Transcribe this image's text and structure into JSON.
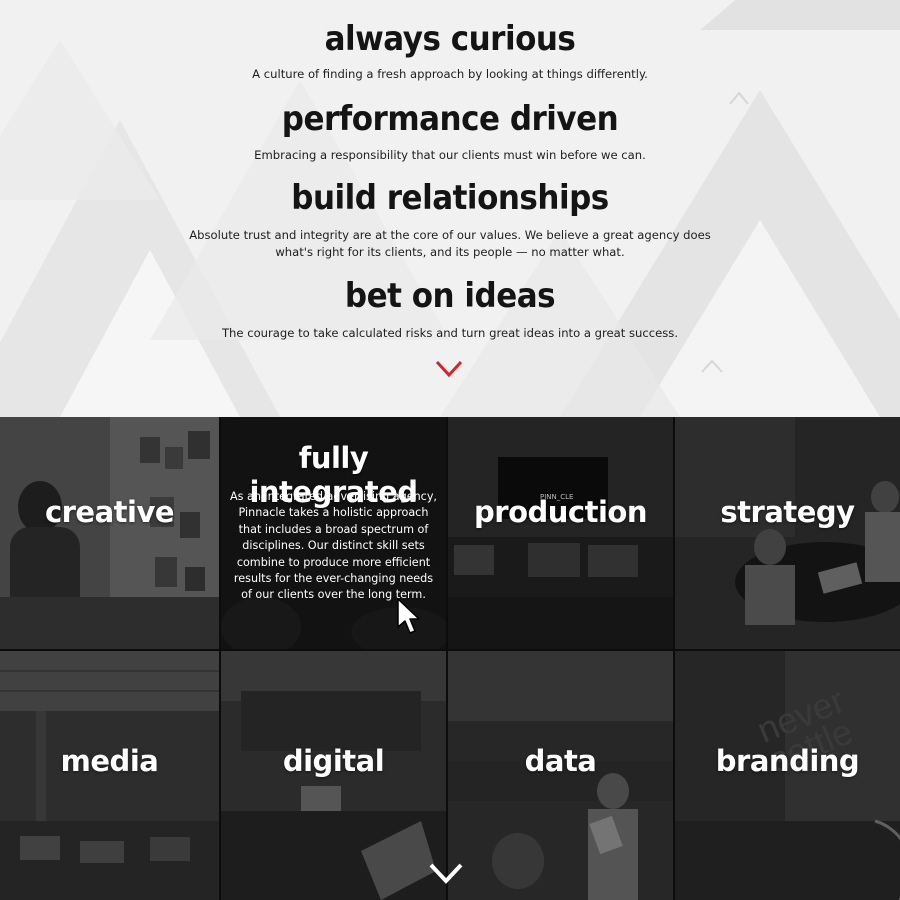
{
  "values": [
    {
      "title": "always curious",
      "description": "A culture of finding a fresh approach by looking at things differently."
    },
    {
      "title": "performance driven",
      "description": "Embracing a responsibility that our clients must win before we can."
    },
    {
      "title": "build relationships",
      "description": "Absolute trust and integrity are at the core of our values. We believe a great agency does what's right for its clients, and its people — no matter what."
    },
    {
      "title": "bet on ideas",
      "description": "The courage to take calculated risks and turn great ideas into a great success."
    }
  ],
  "services": [
    {
      "label": "creative"
    },
    {
      "label": "fully integrated",
      "detail": "As an integrated advertising agency, Pinnacle takes a holistic approach that includes a broad spectrum of disciplines. Our distinct skill sets combine to produce more efficient results for the ever-changing needs of our clients over the long term."
    },
    {
      "label": "production",
      "screen_text": "PINN_CLE"
    },
    {
      "label": "strategy"
    },
    {
      "label": "media"
    },
    {
      "label": "digital"
    },
    {
      "label": "data"
    },
    {
      "label": "branding",
      "wall_text": "never settle"
    }
  ],
  "icons": {
    "next_arrow": "chevron-down-icon",
    "scroll_arrow": "chevron-down-icon",
    "cursor": "pointer-cursor-icon"
  },
  "colors": {
    "accent": "#d0262c",
    "heading": "#141414",
    "grid_text": "#ffffff"
  }
}
